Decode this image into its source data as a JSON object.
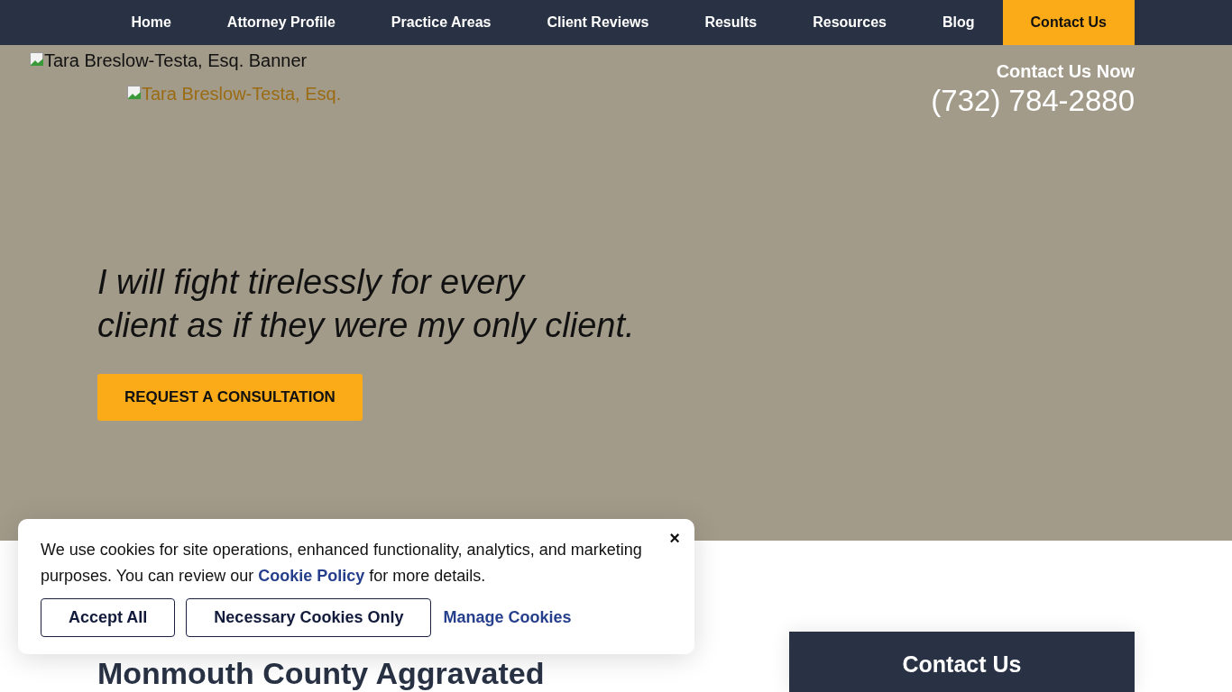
{
  "nav": {
    "items": [
      {
        "label": "Home",
        "selected": false
      },
      {
        "label": "Attorney Profile",
        "selected": false
      },
      {
        "label": "Practice Areas",
        "selected": false
      },
      {
        "label": "Client Reviews",
        "selected": false
      },
      {
        "label": "Results",
        "selected": false
      },
      {
        "label": "Resources",
        "selected": false
      },
      {
        "label": "Blog",
        "selected": false
      },
      {
        "label": "Contact Us",
        "selected": true
      }
    ]
  },
  "hero": {
    "banner_alt": "Tara Breslow-Testa, Esq. Banner",
    "logo_alt": "Tara Breslow-Testa, Esq.",
    "contact_label": "Contact Us Now",
    "phone": "(732) 784-2880",
    "quote_lines": [
      "I will fight tirelessly for every",
      "client as if they were my only client."
    ],
    "cta": "REQUEST A CONSULTATION"
  },
  "main": {
    "heading": "Monmouth County Aggravated",
    "contact_card_title": "Contact Us"
  },
  "cookie_banner": {
    "text_before": "We use cookies for site operations, enhanced functionality, analytics, and marketing purposes. You can review our ",
    "link": "Cookie Policy",
    "text_after": " for more details.",
    "close": "×",
    "buttons": [
      "Accept All",
      "Necessary Cookies Only"
    ],
    "manage": "Manage Cookies"
  }
}
